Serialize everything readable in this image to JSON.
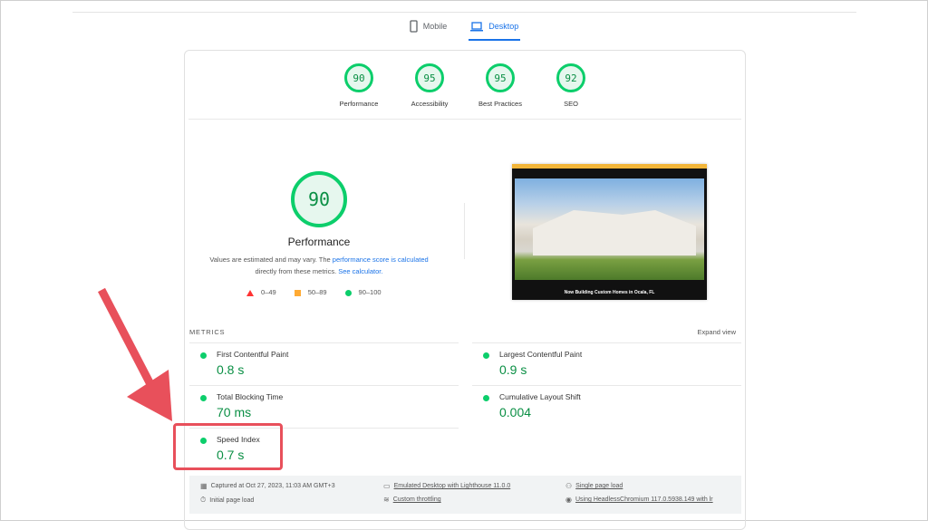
{
  "tabs": [
    {
      "label": "Mobile",
      "icon": "phone-icon"
    },
    {
      "label": "Desktop",
      "icon": "laptop-icon",
      "active": true
    }
  ],
  "gauges": [
    {
      "score": "90",
      "label": "Performance"
    },
    {
      "score": "95",
      "label": "Accessibility"
    },
    {
      "score": "95",
      "label": "Best Practices"
    },
    {
      "score": "92",
      "label": "SEO"
    }
  ],
  "performance": {
    "score": "90",
    "title": "Performance",
    "desc_pre": "Values are estimated and may vary. The ",
    "link1": "performance score is calculated",
    "desc_mid": " directly from these metrics. ",
    "link2": "See calculator.",
    "legend": [
      "0–49",
      "50–89",
      "90–100"
    ]
  },
  "screenshot": {
    "caption": "Now Building Custom Homes in Ocala, FL"
  },
  "metrics": {
    "header": "METRICS",
    "expand": "Expand view",
    "items": [
      {
        "label": "First Contentful Paint",
        "value": "0.8 s"
      },
      {
        "label": "Largest Contentful Paint",
        "value": "0.9 s"
      },
      {
        "label": "Total Blocking Time",
        "value": "70 ms"
      },
      {
        "label": "Cumulative Layout Shift",
        "value": "0.004"
      },
      {
        "label": "Speed Index",
        "value": "0.7 s"
      }
    ]
  },
  "footer": {
    "captured": "Captured at Oct 27, 2023, 11:03 AM GMT+3",
    "initial": "Initial page load",
    "emulated": "Emulated Desktop with Lighthouse 11.0.0",
    "throttling": "Custom throttling",
    "single": "Single page load",
    "chromium": "Using HeadlessChromium 117.0.5938.149 with lr"
  },
  "colors": {
    "pass": "#0cce6b",
    "average": "#ffaa33",
    "fail": "#ff3333",
    "accent": "#1a73e8",
    "annotation": "#e8505b"
  }
}
